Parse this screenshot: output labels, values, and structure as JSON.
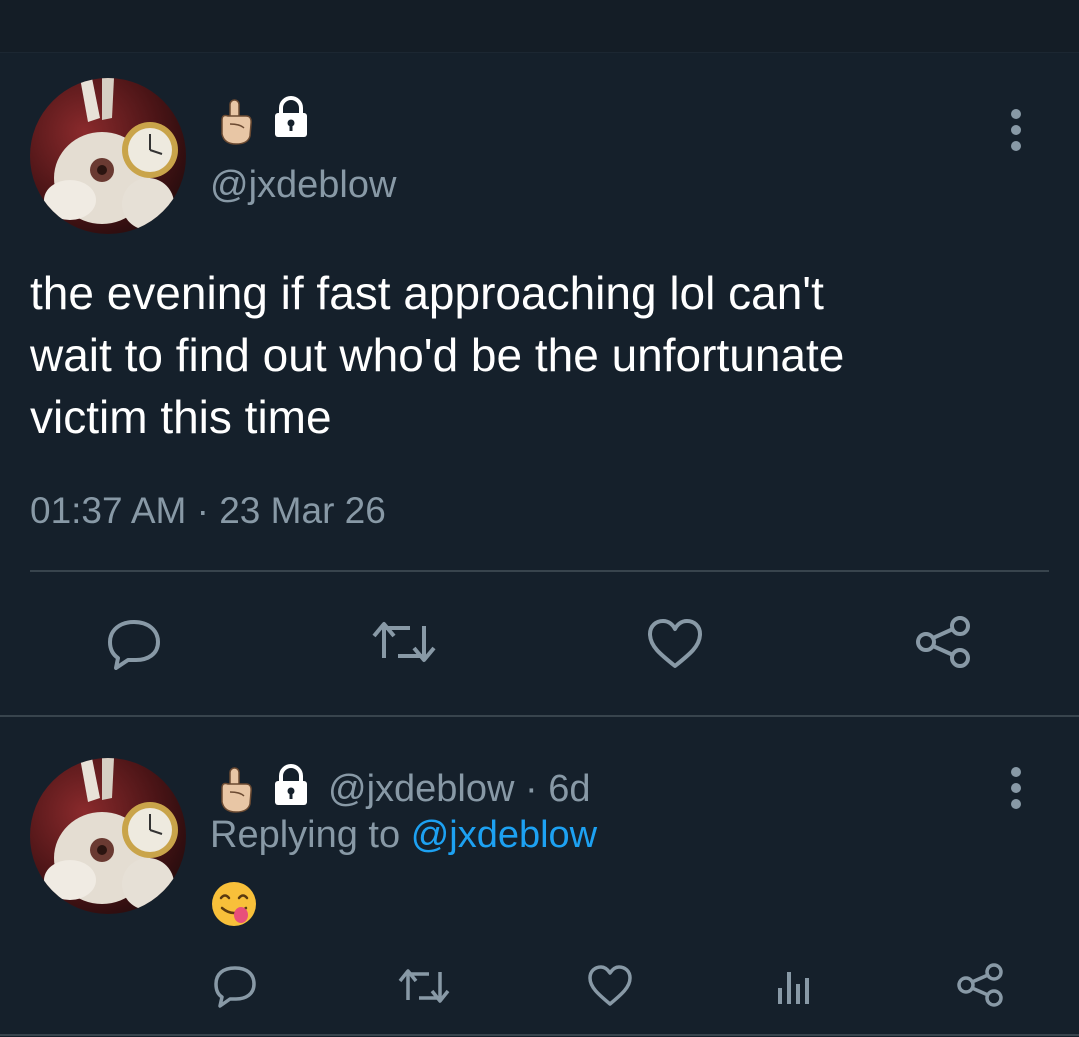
{
  "colors": {
    "background": "#15202b",
    "text_primary": "#ffffff",
    "text_secondary": "#8899a6",
    "link": "#1da1f2",
    "divider": "#38444d"
  },
  "main_tweet": {
    "handle": "@jxdeblow",
    "text_lines": [
      "the evening if fast approaching lol can't",
      "wait to find out who'd be the unfortunate",
      "victim this time"
    ],
    "time": "01:37 AM",
    "separator": "·",
    "date": "23 Mar 26",
    "icons": [
      "pointing-finger-emoji",
      "lock-icon",
      "more-options-icon",
      "reply-icon",
      "retweet-icon",
      "like-icon",
      "share-icon"
    ]
  },
  "reply_tweet": {
    "handle": "@jxdeblow",
    "age": "· 6d",
    "replying_prefix": "Replying to",
    "replying_to": "@jxdeblow",
    "emoji": "yum-face-emoji",
    "icons": [
      "pointing-finger-emoji",
      "lock-icon",
      "more-options-icon",
      "reply-icon",
      "retweet-icon",
      "like-icon",
      "analytics-icon",
      "share-icon"
    ]
  }
}
